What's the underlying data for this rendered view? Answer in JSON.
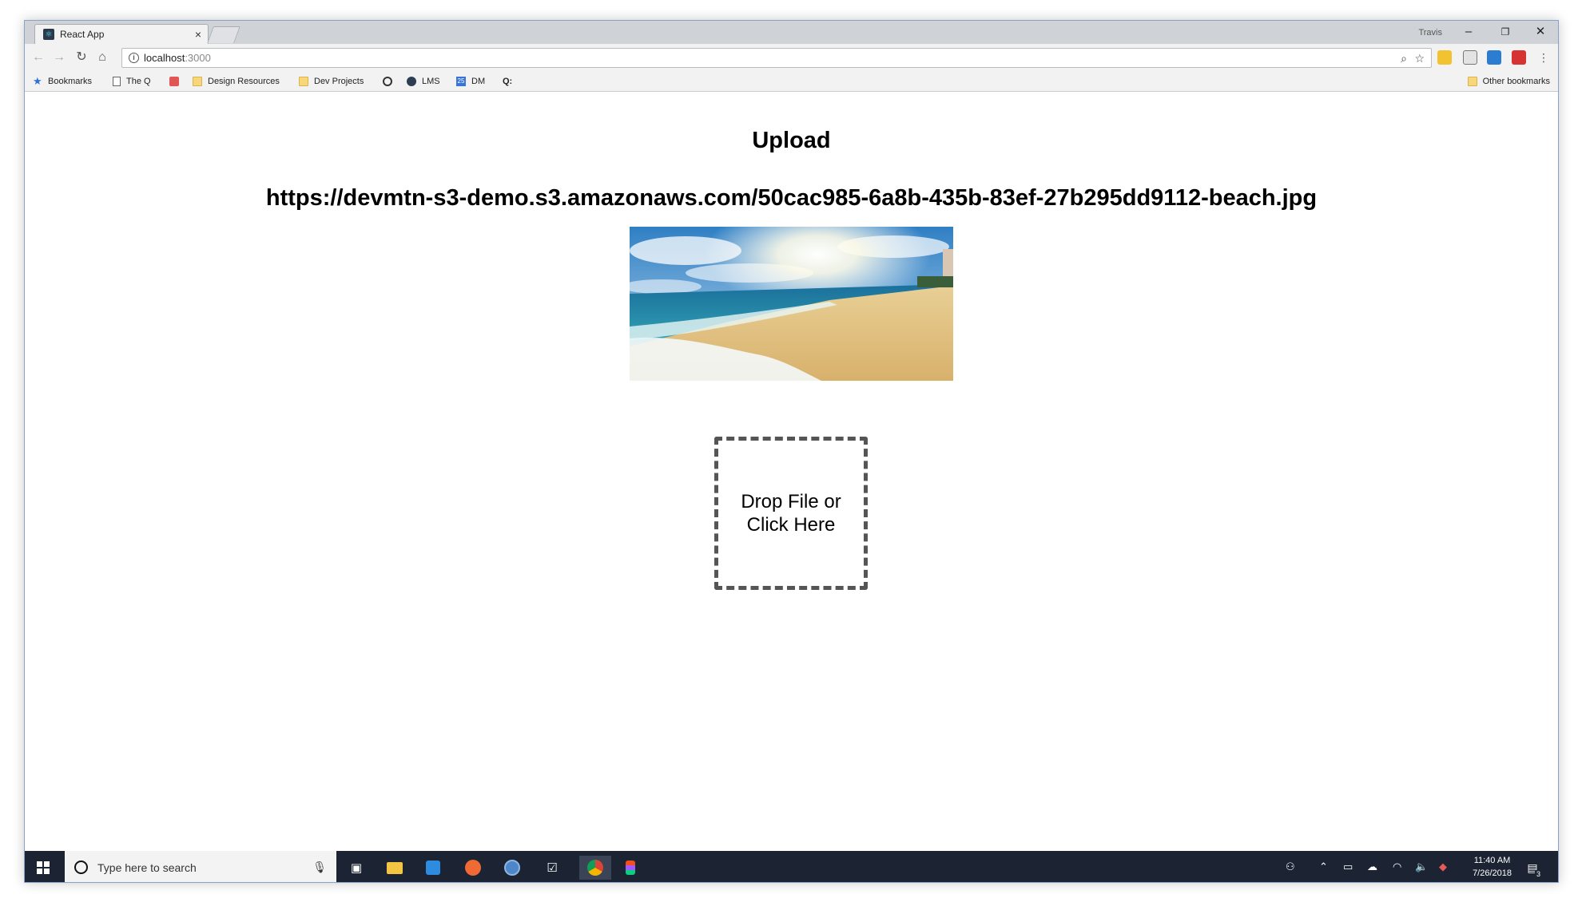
{
  "browser": {
    "tab_title": "React App",
    "tab_close": "×",
    "profile_name": "Travis",
    "window_controls": {
      "minimize": "–",
      "restore": "❐",
      "close": "✕"
    },
    "url_host": "localhost",
    "url_port": ":3000",
    "bookmarks": [
      {
        "label": "Bookmarks",
        "icon": "star-icon"
      },
      {
        "label": "The Q",
        "icon": "page-icon"
      },
      {
        "label": "",
        "icon": "app-icon"
      },
      {
        "label": "Design Resources",
        "icon": "folder-icon"
      },
      {
        "label": "Dev Projects",
        "icon": "folder-icon"
      },
      {
        "label": "",
        "icon": "github-icon"
      },
      {
        "label": "LMS",
        "icon": "circle-icon"
      },
      {
        "label": "DM",
        "icon": "calendar-icon"
      },
      {
        "label": "Q:",
        "icon": "text-icon"
      }
    ],
    "other_bookmarks": "Other bookmarks"
  },
  "page": {
    "heading": "Upload",
    "image_url": "https://devmtn-s3-demo.s3.amazonaws.com/50cac985-6a8b-435b-83ef-27b295dd9112-beach.jpg",
    "dropzone_text": "Drop File or Click Here"
  },
  "taskbar": {
    "search_placeholder": "Type here to search",
    "time": "11:40 AM",
    "date": "7/26/2018",
    "notification_count": "3"
  },
  "colors": {
    "taskbar": "#1c2433",
    "dropzone_border": "#555555"
  }
}
